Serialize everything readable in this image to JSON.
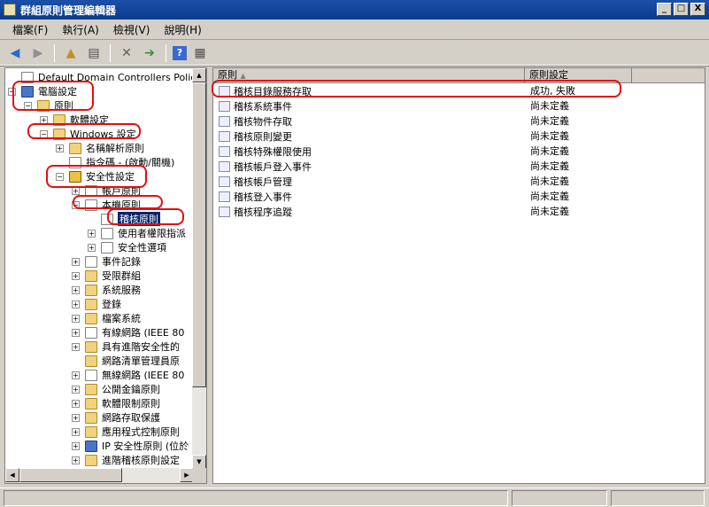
{
  "window": {
    "title": "群組原則管理編輯器",
    "min": "_",
    "max": "□",
    "close": "X"
  },
  "menu": [
    "檔案(F)",
    "執行(A)",
    "檢視(V)",
    "說明(H)"
  ],
  "toolbar": {
    "icons": [
      "back-arrow-icon",
      "forward-arrow-icon",
      "up-folder-icon",
      "show-hide-tree-icon",
      "delete-icon",
      "export-icon",
      "help-icon",
      "properties-icon"
    ]
  },
  "tree": [
    {
      "label": "Default Domain Controllers Policy [SER",
      "pm": "",
      "icon": "doc"
    },
    {
      "label": "電腦設定",
      "pm": "−",
      "icon": "pc"
    },
    {
      "label": "原則",
      "pm": "−",
      "icon": "folder"
    },
    {
      "label": "軟體設定",
      "pm": "+",
      "icon": "folder"
    },
    {
      "label": "Windows 設定",
      "pm": "−",
      "icon": "folder"
    },
    {
      "label": "名稱解析原則",
      "pm": "+",
      "icon": "folder"
    },
    {
      "label": "指令碼 - (啟動/關機)",
      "pm": "",
      "icon": "doc"
    },
    {
      "label": "安全性設定",
      "pm": "−",
      "icon": "shield"
    },
    {
      "label": "帳戶原則",
      "pm": "+",
      "icon": "doc"
    },
    {
      "label": "本機原則",
      "pm": "−",
      "icon": "doc"
    },
    {
      "label": "稽核原則",
      "pm": "",
      "icon": "doc",
      "selected": true
    },
    {
      "label": "使用者權限指派",
      "pm": "+",
      "icon": "doc"
    },
    {
      "label": "安全性選項",
      "pm": "+",
      "icon": "doc"
    },
    {
      "label": "事件記錄",
      "pm": "+",
      "icon": "doc"
    },
    {
      "label": "受限群組",
      "pm": "+",
      "icon": "folder"
    },
    {
      "label": "系統服務",
      "pm": "+",
      "icon": "folder"
    },
    {
      "label": "登錄",
      "pm": "+",
      "icon": "folder"
    },
    {
      "label": "檔案系統",
      "pm": "+",
      "icon": "folder"
    },
    {
      "label": "有線網路 (IEEE 80",
      "pm": "+",
      "icon": "doc"
    },
    {
      "label": "具有進階安全性的",
      "pm": "+",
      "icon": "folder"
    },
    {
      "label": "網路清單管理員原",
      "pm": "",
      "icon": "folder"
    },
    {
      "label": "無線網路 (IEEE 80",
      "pm": "+",
      "icon": "doc"
    },
    {
      "label": "公開金鑰原則",
      "pm": "+",
      "icon": "folder"
    },
    {
      "label": "軟體限制原則",
      "pm": "+",
      "icon": "folder"
    },
    {
      "label": "網路存取保護",
      "pm": "+",
      "icon": "folder"
    },
    {
      "label": "應用程式控制原則",
      "pm": "+",
      "icon": "folder"
    },
    {
      "label": "IP 安全性原則 (位於",
      "pm": "+",
      "icon": "pc"
    },
    {
      "label": "進階稽核原則設定",
      "pm": "+",
      "icon": "folder"
    }
  ],
  "list": {
    "col_policy": "原則",
    "col_setting": "原則設定",
    "rows": [
      {
        "name": "稽核目錄服務存取",
        "setting": "成功, 失敗"
      },
      {
        "name": "稽核系統事件",
        "setting": "尚未定義"
      },
      {
        "name": "稽核物件存取",
        "setting": "尚未定義"
      },
      {
        "name": "稽核原則變更",
        "setting": "尚未定義"
      },
      {
        "name": "稽核特殊權限使用",
        "setting": "尚未定義"
      },
      {
        "name": "稽核帳戶登入事件",
        "setting": "尚未定義"
      },
      {
        "name": "稽核帳戶管理",
        "setting": "尚未定義"
      },
      {
        "name": "稽核登入事件",
        "setting": "尚未定義"
      },
      {
        "name": "稽核程序追蹤",
        "setting": "尚未定義"
      }
    ]
  }
}
